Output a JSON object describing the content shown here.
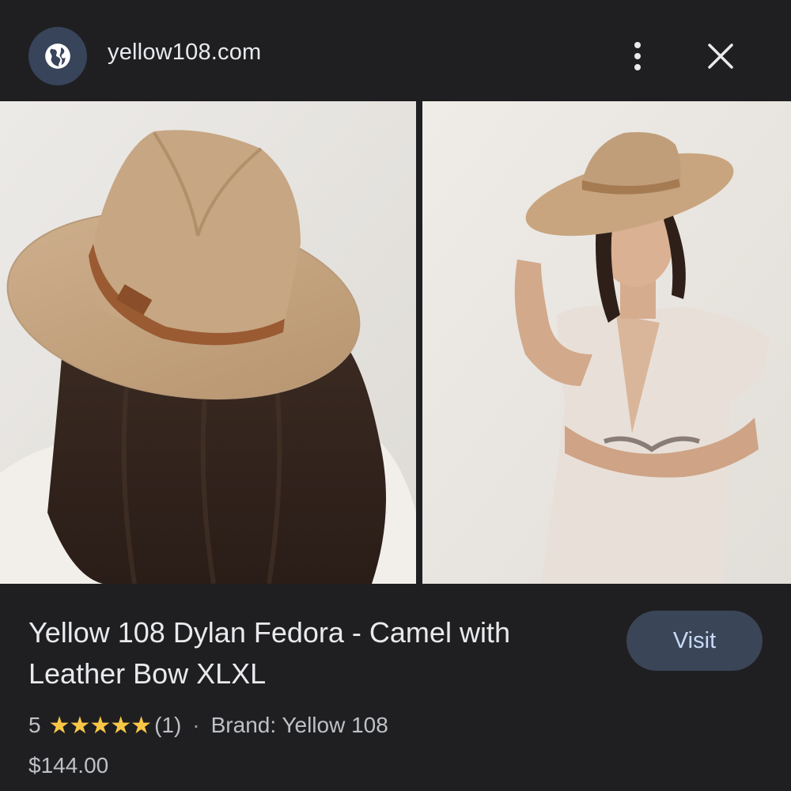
{
  "header": {
    "site_icon": "globe-icon",
    "url": "yellow108.com",
    "more_icon": "more-vert-icon",
    "close_icon": "close-icon"
  },
  "images": [
    {
      "description_icon": "product-photo-back-view"
    },
    {
      "description_icon": "product-photo-model-view"
    }
  ],
  "product": {
    "title": "Yellow 108 Dylan Fedora - Camel with Leather Bow XLXL",
    "rating": "5",
    "stars": "★★★★★",
    "review_count": "(1)",
    "separator": "·",
    "brand": "Brand: Yellow 108",
    "price": "$144.00"
  },
  "actions": {
    "visit_label": "Visit"
  },
  "colors": {
    "background": "#1f1f21",
    "badge": "#37445a",
    "visit_button": "#3a4558",
    "visit_text": "#c9daf8",
    "star": "#f9c747"
  }
}
